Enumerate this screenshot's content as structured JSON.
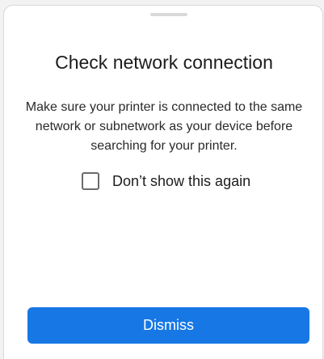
{
  "dialog": {
    "title": "Check network connection",
    "message": "Make sure your printer is connected to the same network or subnetwork as your device before searching for your printer.",
    "checkbox": {
      "label": "Don’t show this again",
      "checked": false
    },
    "dismiss_label": "Dismiss"
  },
  "colors": {
    "primary": "#1677e5",
    "text": "#1c1c1c",
    "checkbox_border": "#6b6b6b"
  }
}
